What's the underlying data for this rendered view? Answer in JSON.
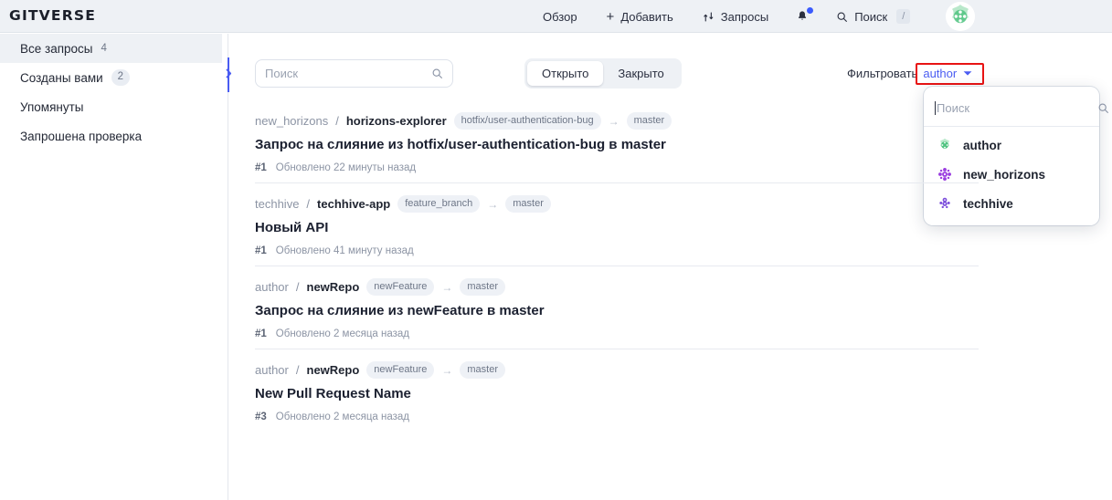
{
  "header": {
    "logo": "GITVERSE",
    "nav": [
      {
        "label": "Обзор",
        "icon": "none"
      },
      {
        "label": "Добавить",
        "icon": "plus-icon"
      },
      {
        "label": "Запросы",
        "icon": "pull-request-icon"
      }
    ],
    "notifications": {
      "icon": "bell-icon",
      "has_unread": true,
      "dot_color": "#3b5bfd"
    },
    "search": {
      "label": "Поиск",
      "icon": "search-icon",
      "shortcut": "/"
    },
    "avatar": {
      "icon": "user-avatar-identicon",
      "color": "#5cc98a"
    }
  },
  "sidebar": {
    "items": [
      {
        "label": "Все запросы",
        "count": "4",
        "active": true
      },
      {
        "label": "Созданы вами",
        "count": "2",
        "active": false
      },
      {
        "label": "Упомянуты",
        "count": "",
        "active": false
      },
      {
        "label": "Запрошена проверка",
        "count": "",
        "active": false
      }
    ],
    "collapse_icon": "chevron-right-icon"
  },
  "toolbar": {
    "search": {
      "placeholder": "Поиск",
      "value": "",
      "icon": "search-icon"
    },
    "tabs": [
      {
        "label": "Открыто",
        "active": true
      },
      {
        "label": "Закрыто",
        "active": false
      }
    ],
    "filter": {
      "label": "Фильтровать",
      "selected": "author",
      "chevron": "chevron-down-icon",
      "accent": "#4a5cf2",
      "highlight_color": "#e81313"
    }
  },
  "dropdown": {
    "search": {
      "placeholder": "Поиск",
      "value": "",
      "icon": "search-icon"
    },
    "options": [
      {
        "label": "author",
        "avatar": "identicon-green",
        "color": "#5cc98a"
      },
      {
        "label": "new_horizons",
        "avatar": "identicon-purple",
        "color": "#9b3fe0"
      },
      {
        "label": "techhive",
        "avatar": "identicon-violet",
        "color": "#7b4ddb"
      }
    ]
  },
  "pull_requests": [
    {
      "owner": "new_horizons",
      "repo": "horizons-explorer",
      "source_branch": "hotfix/user-authentication-bug",
      "target_branch": "master",
      "title": "Запрос на слияние из hotfix/user-authentication-bug в master",
      "number": "#1",
      "updated": "Обновлено 22 минуты назад"
    },
    {
      "owner": "techhive",
      "repo": "techhive-app",
      "source_branch": "feature_branch",
      "target_branch": "master",
      "title": "Новый API",
      "number": "#1",
      "updated": "Обновлено 41 минуту назад"
    },
    {
      "owner": "author",
      "repo": "newRepo",
      "source_branch": "newFeature",
      "target_branch": "master",
      "title": "Запрос на слияние из newFeature в master",
      "number": "#1",
      "updated": "Обновлено 2 месяца назад"
    },
    {
      "owner": "author",
      "repo": "newRepo",
      "source_branch": "newFeature",
      "target_branch": "master",
      "title": "New Pull Request Name",
      "number": "#3",
      "updated": "Обновлено 2 месяца назад"
    }
  ]
}
